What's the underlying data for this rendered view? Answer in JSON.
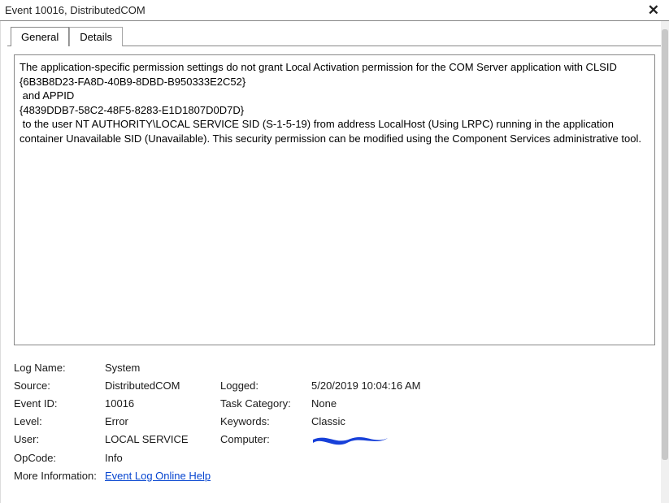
{
  "title": "Event 10016, DistributedCOM",
  "tabs": {
    "general": "General",
    "details": "Details"
  },
  "description": "The application-specific permission settings do not grant Local Activation permission for the COM Server application with CLSID\n{6B3B8D23-FA8D-40B9-8DBD-B950333E2C52}\n and APPID\n{4839DDB7-58C2-48F5-8283-E1D1807D0D7D}\n to the user NT AUTHORITY\\LOCAL SERVICE SID (S-1-5-19) from address LocalHost (Using LRPC) running in the application container Unavailable SID (Unavailable). This security permission can be modified using the Component Services administrative tool.",
  "labels": {
    "logName": "Log Name:",
    "source": "Source:",
    "eventId": "Event ID:",
    "level": "Level:",
    "user": "User:",
    "opcode": "OpCode:",
    "moreInfo": "More Information:",
    "logged": "Logged:",
    "taskCategory": "Task Category:",
    "keywords": "Keywords:",
    "computer": "Computer:"
  },
  "values": {
    "logName": "System",
    "source": "DistributedCOM",
    "eventId": "10016",
    "level": "Error",
    "user": "LOCAL SERVICE",
    "opcode": "Info",
    "moreInfoLink": "Event Log Online Help",
    "logged": "5/20/2019 10:04:16 AM",
    "taskCategory": "None",
    "keywords": "Classic"
  }
}
